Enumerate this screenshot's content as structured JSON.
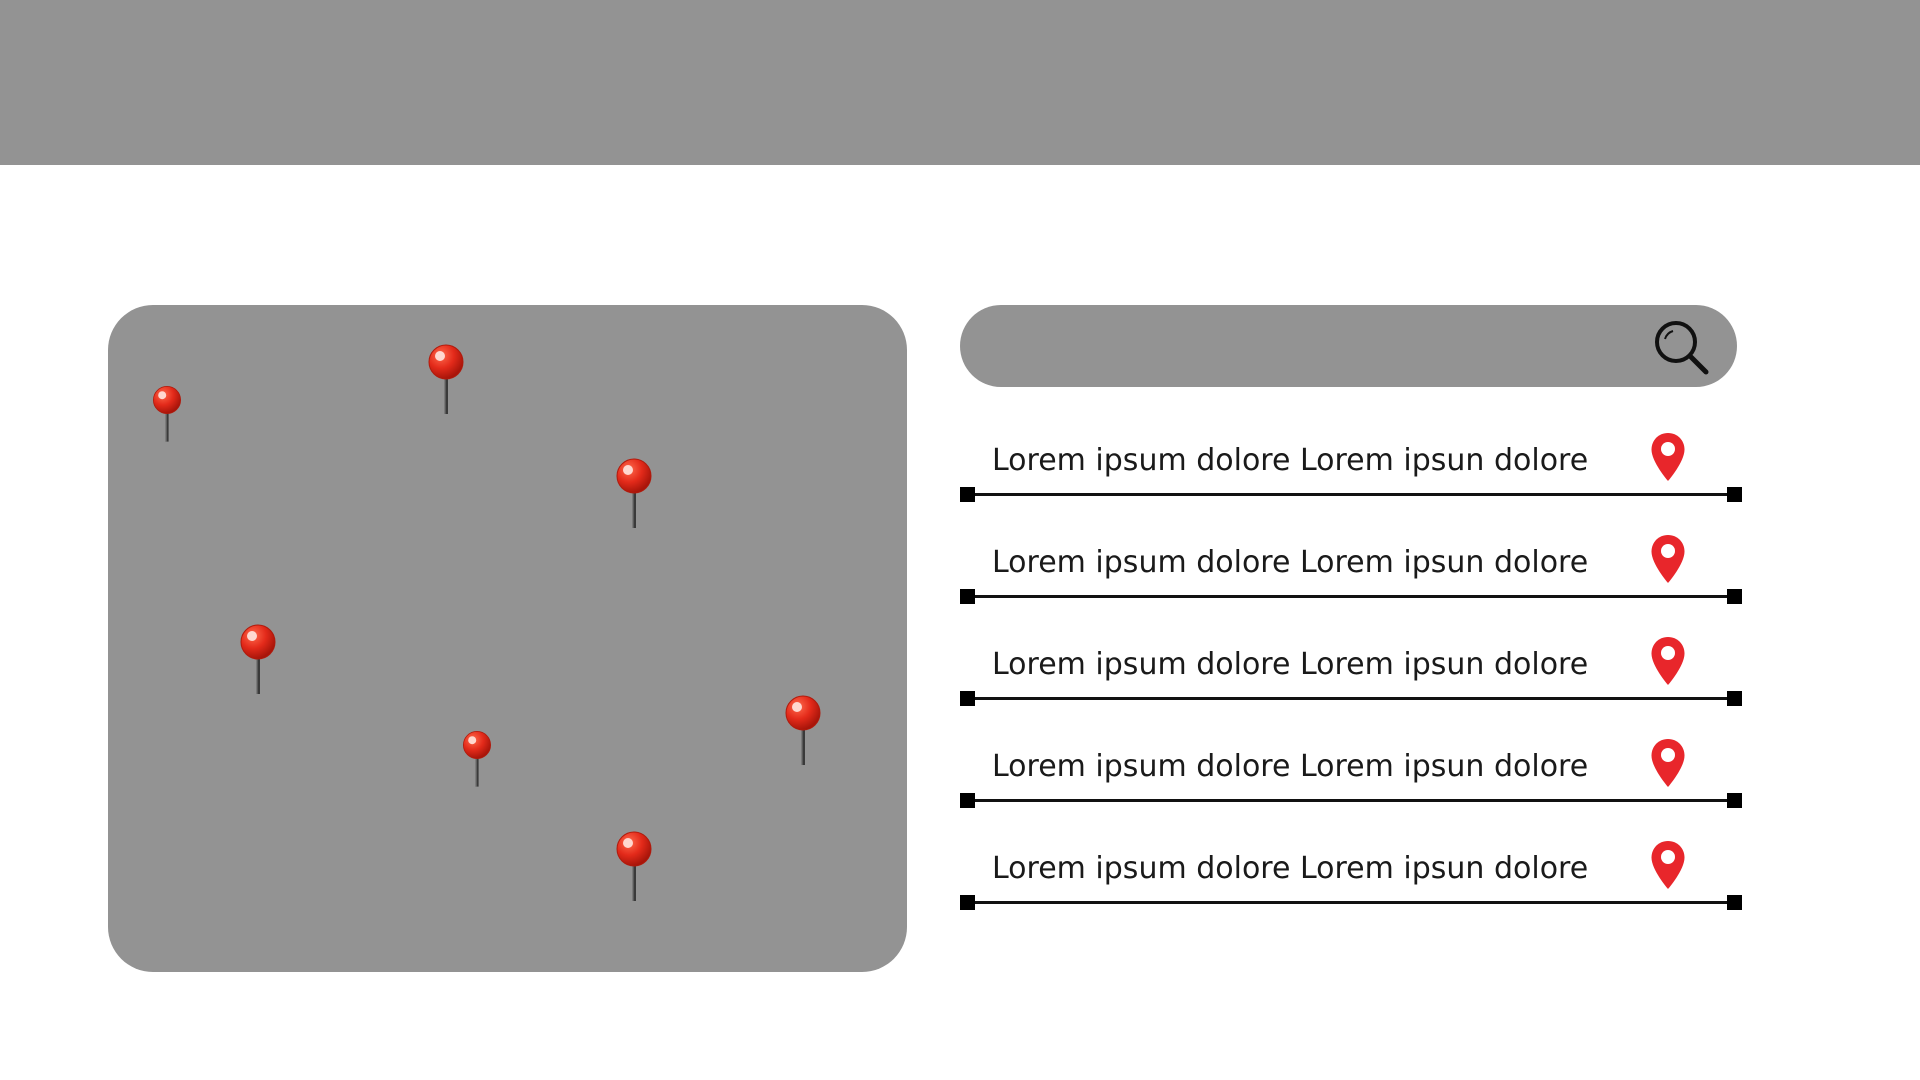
{
  "header": {
    "color": "#939393"
  },
  "map": {
    "pin_icon": "pushpin-icon",
    "pin_color": "#e32a1a",
    "pin_count": 7
  },
  "search": {
    "placeholder": "",
    "icon": "search-icon"
  },
  "results": [
    {
      "label": "Lorem ipsum dolore Lorem ipsun dolore",
      "icon": "location-pin-icon"
    },
    {
      "label": "Lorem ipsum dolore Lorem ipsun dolore",
      "icon": "location-pin-icon"
    },
    {
      "label": "Lorem ipsum dolore Lorem ipsun dolore",
      "icon": "location-pin-icon"
    },
    {
      "label": "Lorem ipsum dolore Lorem ipsun dolore",
      "icon": "location-pin-icon"
    },
    {
      "label": "Lorem ipsum dolore Lorem ipsun dolore",
      "icon": "location-pin-icon"
    }
  ],
  "colors": {
    "panel": "#939393",
    "accent": "#e8262b",
    "text": "#1a1a1a"
  }
}
